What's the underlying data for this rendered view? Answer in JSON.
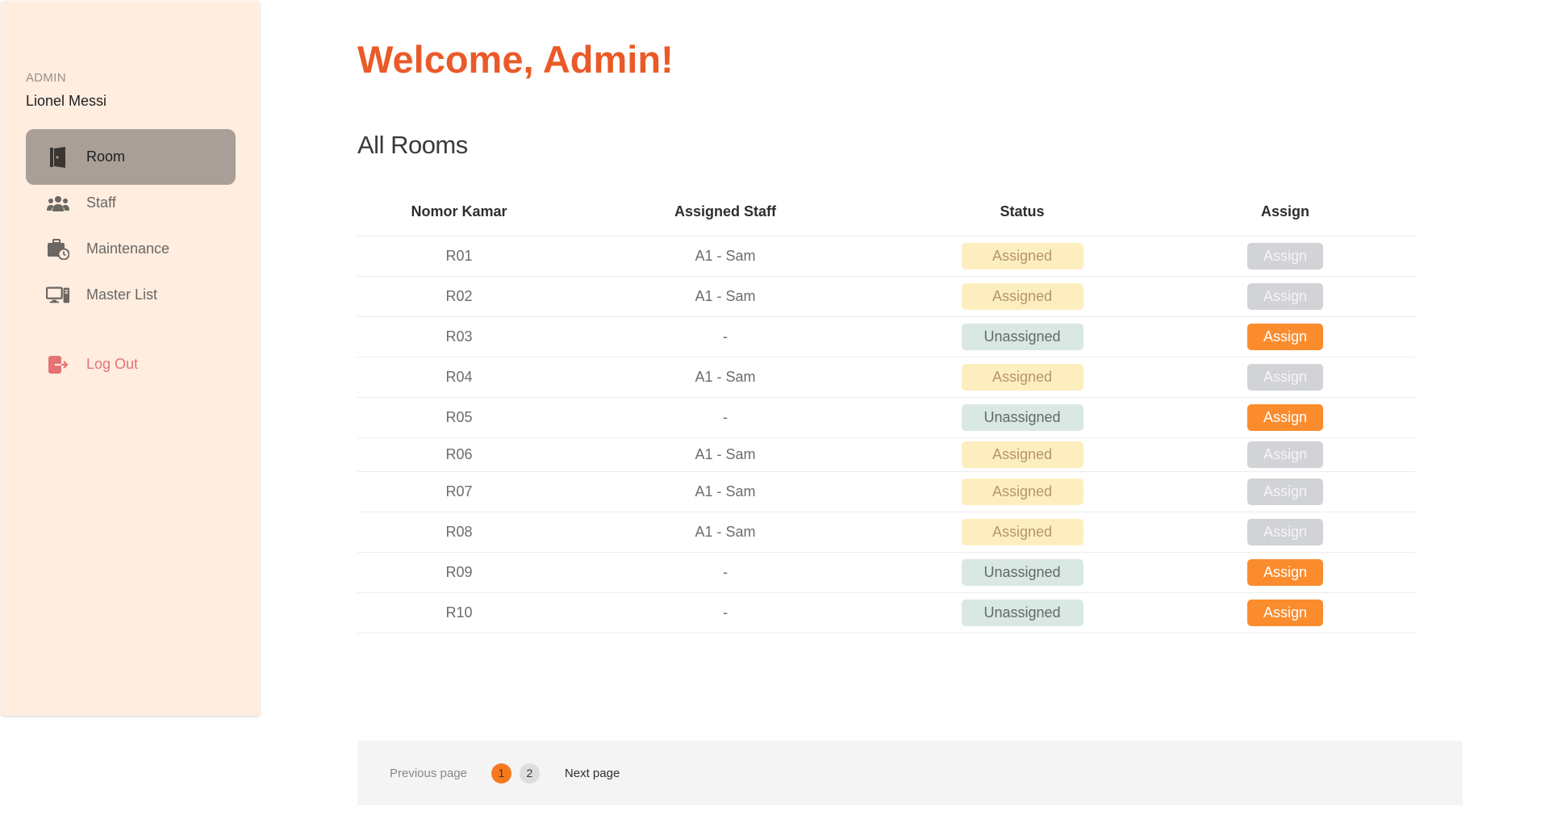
{
  "sidebar": {
    "role": "ADMIN",
    "user_name": "Lionel Messi",
    "items": [
      {
        "label": "Room",
        "icon": "door-icon"
      },
      {
        "label": "Staff",
        "icon": "users-icon"
      },
      {
        "label": "Maintenance",
        "icon": "briefcase-clock-icon"
      },
      {
        "label": "Master List",
        "icon": "desktop-icon"
      }
    ],
    "logout": {
      "label": "Log Out",
      "icon": "logout-icon"
    }
  },
  "main": {
    "welcome": "Welcome, Admin!",
    "section_title": "All Rooms",
    "table": {
      "headers": [
        "Nomor Kamar",
        "Assigned Staff",
        "Status",
        "Assign"
      ],
      "rows": [
        {
          "room": "R01",
          "staff": "A1 - Sam",
          "status": "Assigned",
          "assign": "Assign"
        },
        {
          "room": "R02",
          "staff": "A1 - Sam",
          "status": "Assigned",
          "assign": "Assign"
        },
        {
          "room": "R03",
          "staff": "-",
          "status": "Unassigned",
          "assign": "Assign"
        },
        {
          "room": "R04",
          "staff": "A1 - Sam",
          "status": "Assigned",
          "assign": "Assign"
        },
        {
          "room": "R05",
          "staff": "-",
          "status": "Unassigned",
          "assign": "Assign"
        },
        {
          "room": "R06",
          "staff": "A1 - Sam",
          "status": "Assigned",
          "assign": "Assign"
        },
        {
          "room": "R07",
          "staff": "A1 - Sam",
          "status": "Assigned",
          "assign": "Assign"
        },
        {
          "room": "R08",
          "staff": "A1 - Sam",
          "status": "Assigned",
          "assign": "Assign"
        },
        {
          "room": "R09",
          "staff": "-",
          "status": "Unassigned",
          "assign": "Assign"
        },
        {
          "room": "R10",
          "staff": "-",
          "status": "Unassigned",
          "assign": "Assign"
        }
      ]
    },
    "pagination": {
      "previous": "Previous page",
      "pages": [
        "1",
        "2"
      ],
      "current": "1",
      "next": "Next page"
    }
  },
  "colors": {
    "accent": "#ea5a29",
    "sidebar_bg": "#ffede0",
    "active_nav": "#aa9f97",
    "assign_active": "#fb8c2e",
    "assign_disabled": "#d1d3d6",
    "status_assigned": "#fdeec0",
    "status_unassigned": "#d9e8e3"
  }
}
